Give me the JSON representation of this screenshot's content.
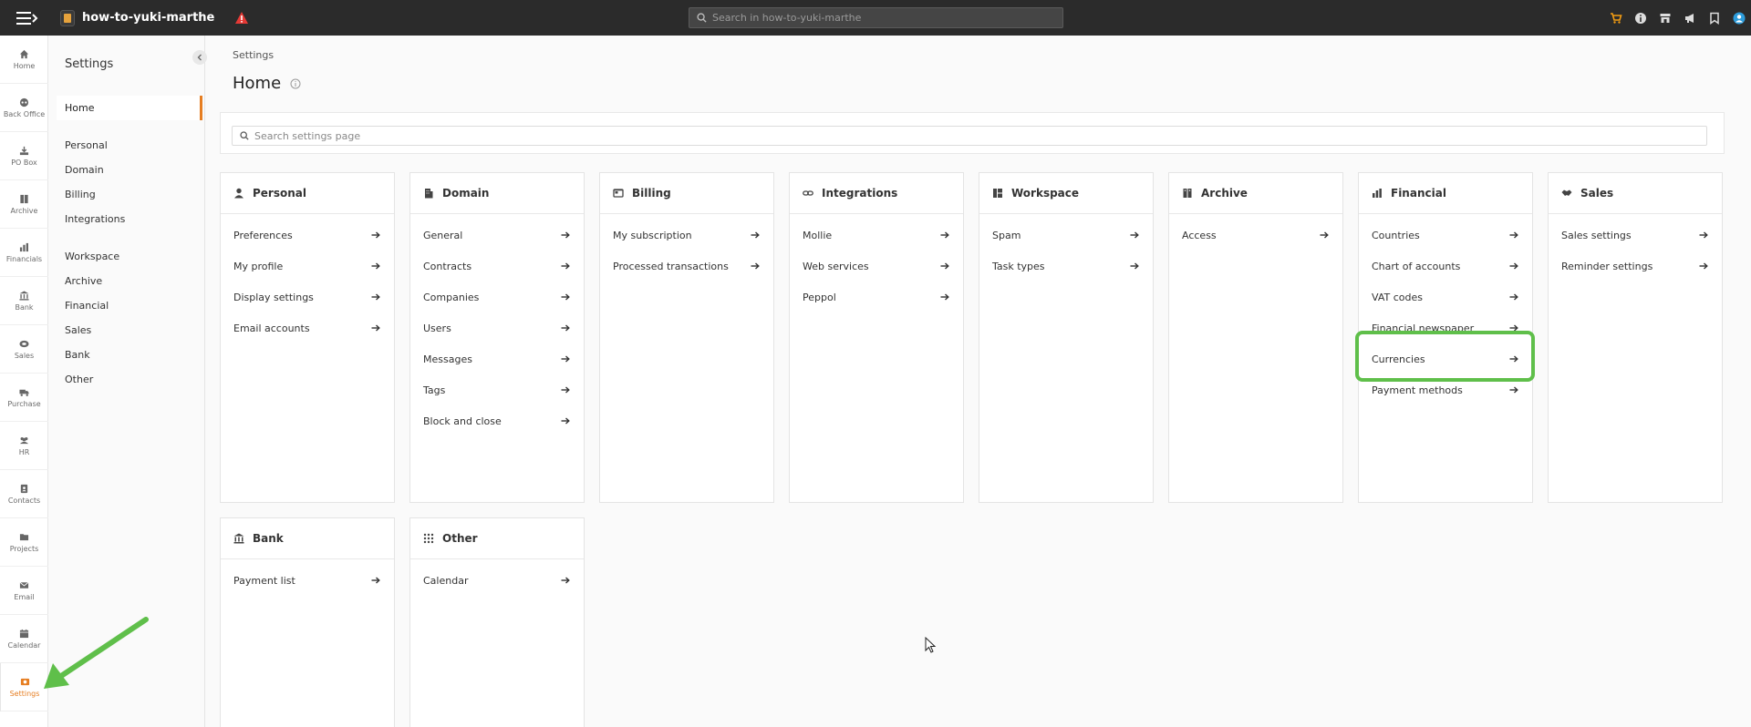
{
  "topbar": {
    "app_name": "how-to-yuki-marthe",
    "search_placeholder": "Search in how-to-yuki-marthe",
    "icons": [
      "cart-icon",
      "info-icon",
      "store-icon",
      "megaphone-icon",
      "bookmark-icon",
      "user-avatar-icon"
    ],
    "accent_color": "#e67e22"
  },
  "rail": {
    "items": [
      {
        "label": "Home",
        "icon": "home-icon"
      },
      {
        "label": "Back Office",
        "icon": "back-office-icon"
      },
      {
        "label": "PO Box",
        "icon": "inbox-icon"
      },
      {
        "label": "Archive",
        "icon": "archive-icon"
      },
      {
        "label": "Financials",
        "icon": "chart-icon"
      },
      {
        "label": "Bank",
        "icon": "bank-icon"
      },
      {
        "label": "Sales",
        "icon": "sales-icon"
      },
      {
        "label": "Purchase",
        "icon": "truck-icon"
      },
      {
        "label": "HR",
        "icon": "people-icon"
      },
      {
        "label": "Contacts",
        "icon": "contacts-icon"
      },
      {
        "label": "Projects",
        "icon": "folder-icon"
      },
      {
        "label": "Email",
        "icon": "mail-icon"
      },
      {
        "label": "Calendar",
        "icon": "calendar-icon"
      },
      {
        "label": "Settings",
        "icon": "gear-icon"
      }
    ]
  },
  "sidepanel": {
    "title": "Settings",
    "home": "Home",
    "group1": [
      "Personal",
      "Domain",
      "Billing",
      "Integrations"
    ],
    "group2": [
      "Workspace",
      "Archive",
      "Financial",
      "Sales",
      "Bank",
      "Other"
    ]
  },
  "main": {
    "breadcrumb": "Settings",
    "title": "Home",
    "search_placeholder": "Search settings page"
  },
  "cards": [
    {
      "title": "Personal",
      "icon": "person-icon",
      "rows": [
        "Preferences",
        "My profile",
        "Display settings",
        "Email accounts"
      ]
    },
    {
      "title": "Domain",
      "icon": "building-icon",
      "rows": [
        "General",
        "Contracts",
        "Companies",
        "Users",
        "Messages",
        "Tags",
        "Block and close"
      ]
    },
    {
      "title": "Billing",
      "icon": "billing-icon",
      "rows": [
        "My subscription",
        "Processed transactions"
      ]
    },
    {
      "title": "Integrations",
      "icon": "link-icon",
      "rows": [
        "Mollie",
        "Web services",
        "Peppol"
      ]
    },
    {
      "title": "Workspace",
      "icon": "workspace-icon",
      "rows": [
        "Spam",
        "Task types"
      ]
    },
    {
      "title": "Archive",
      "icon": "archive-icon",
      "rows": [
        "Access"
      ]
    },
    {
      "title": "Financial",
      "icon": "bar-chart-icon",
      "rows": [
        "Countries",
        "Chart of accounts",
        "VAT codes",
        "Financial newspaper",
        "Currencies",
        "Payment methods"
      ]
    },
    {
      "title": "Sales",
      "icon": "handshake-icon",
      "rows": [
        "Sales settings",
        "Reminder settings"
      ]
    },
    {
      "title": "Bank",
      "icon": "bank-icon",
      "rows": [
        "Payment list"
      ]
    },
    {
      "title": "Other",
      "icon": "grid-icon",
      "rows": [
        "Calendar"
      ]
    }
  ]
}
